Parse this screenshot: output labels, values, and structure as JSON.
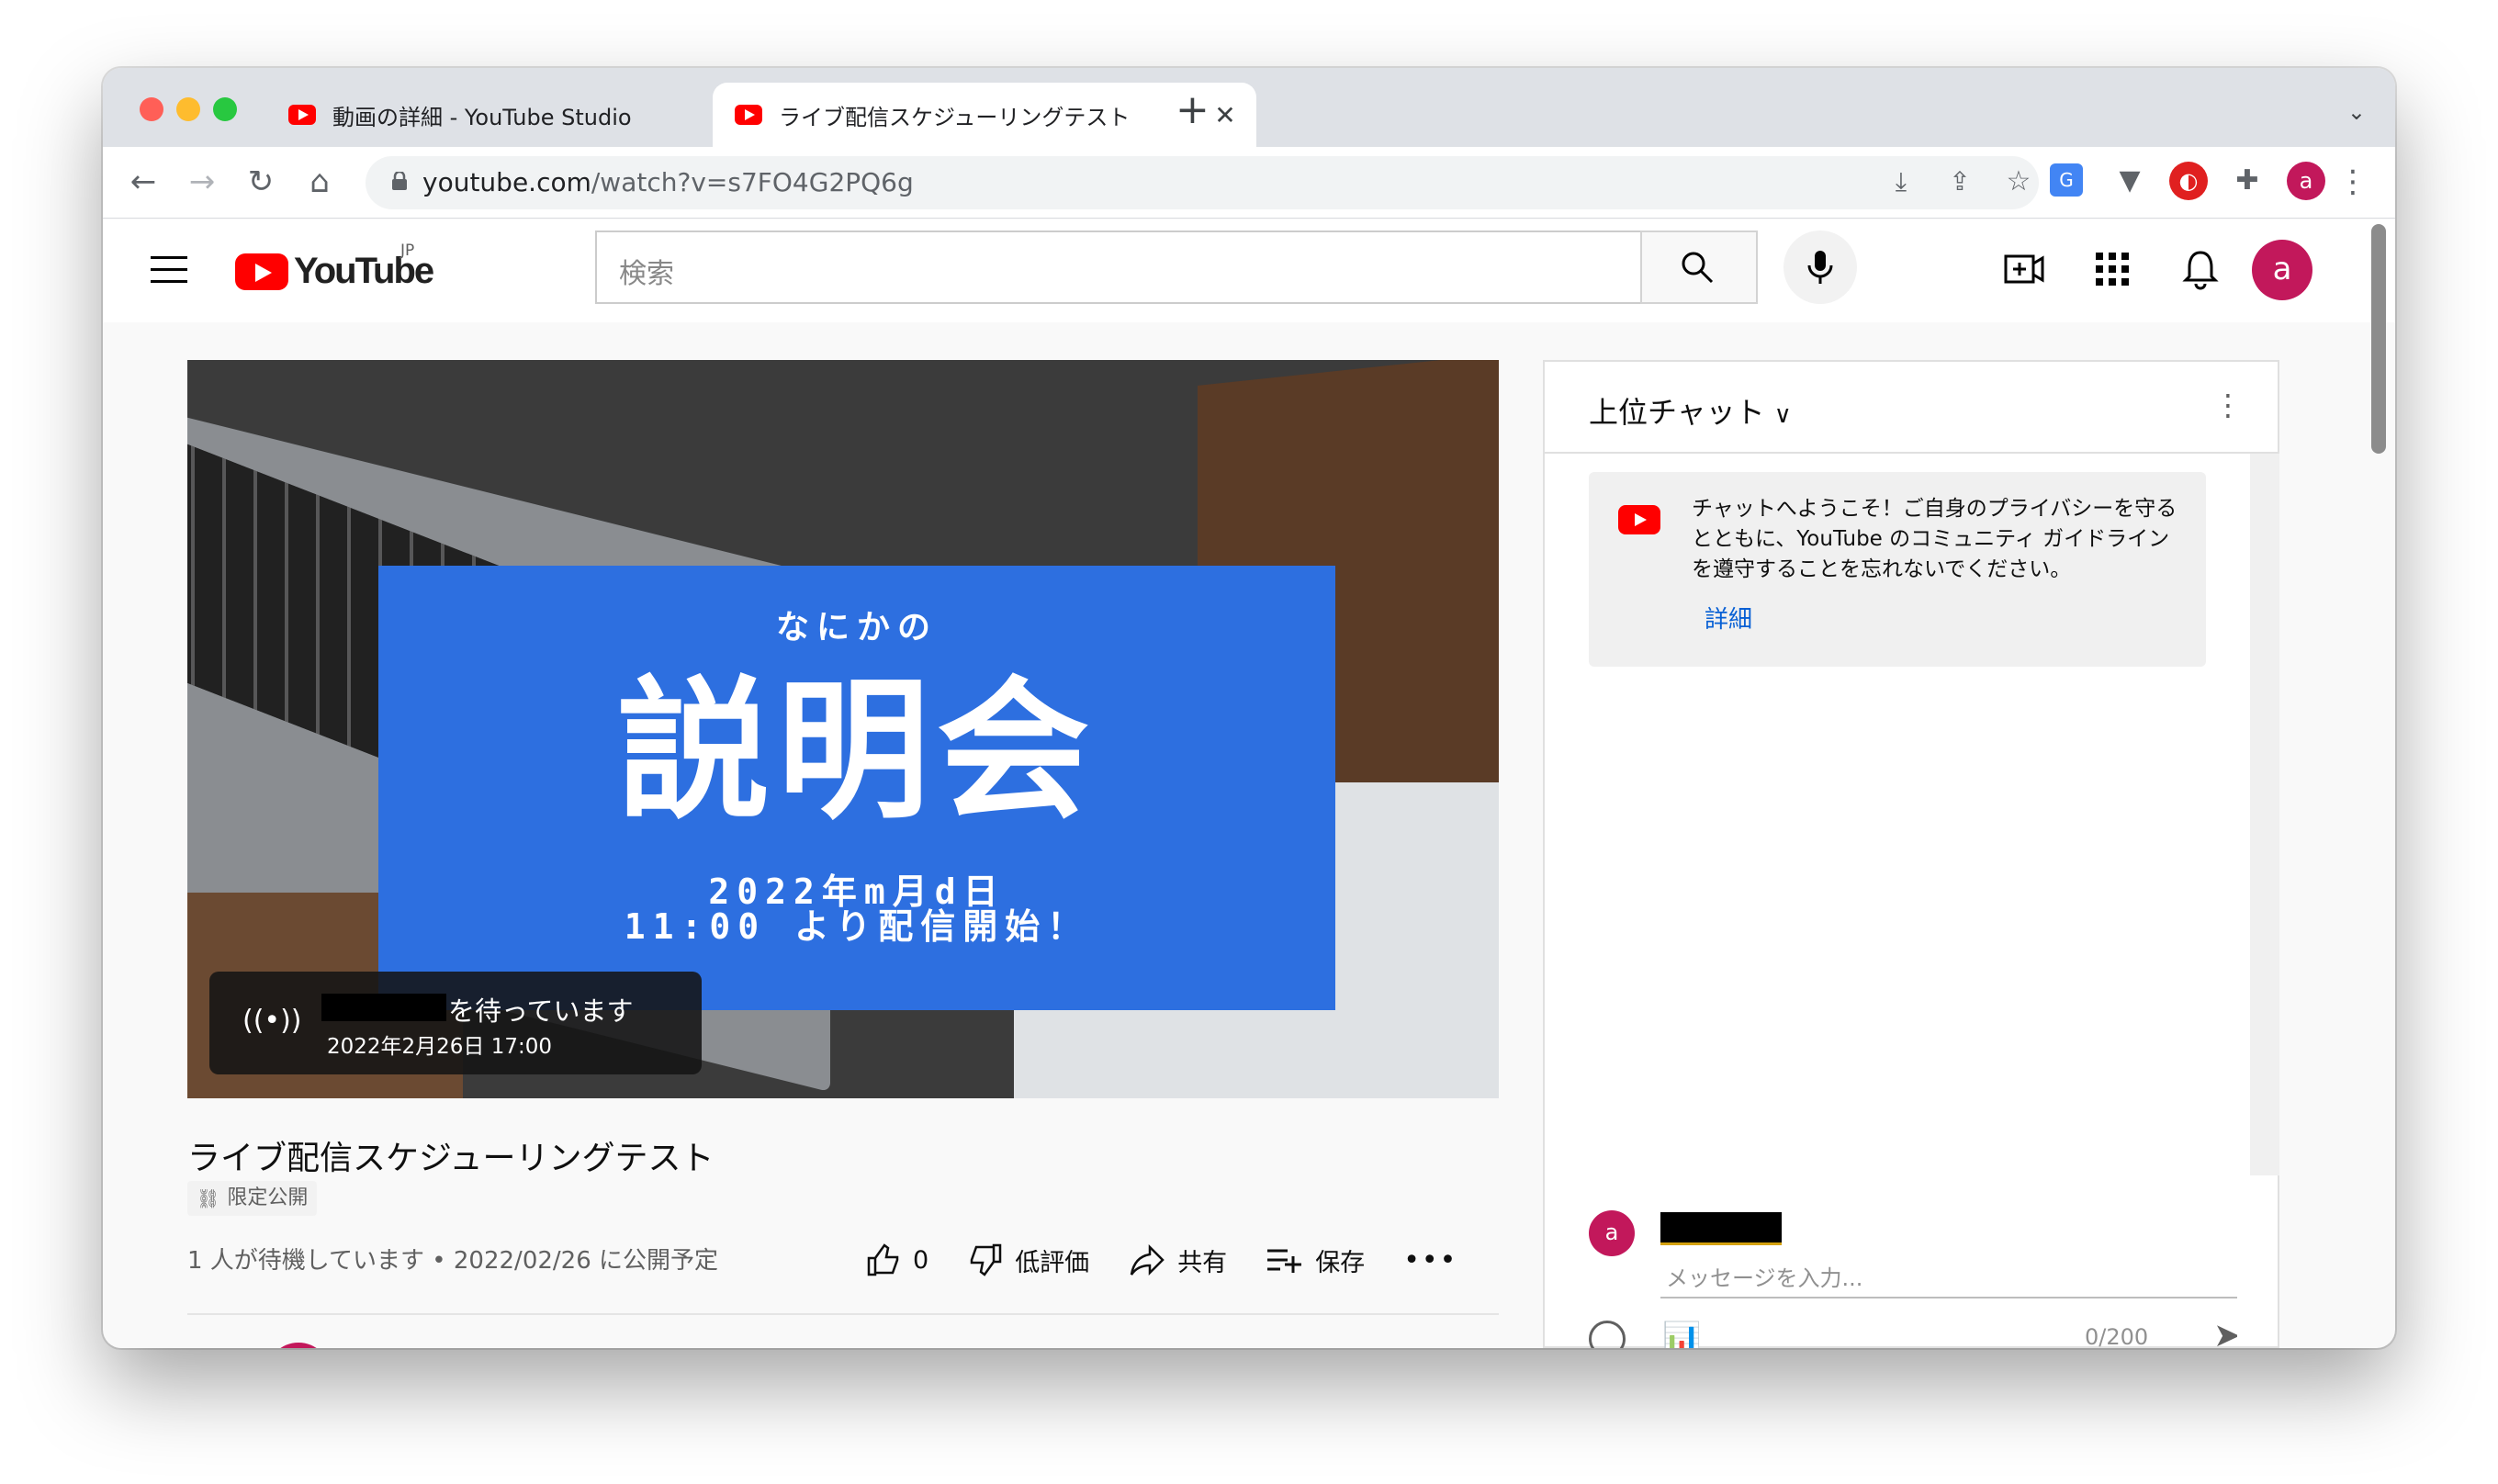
{
  "browser": {
    "tabs": [
      {
        "title": "動画の詳細 - YouTube Studio",
        "active": false
      },
      {
        "title": "ライブ配信スケジューリングテスト",
        "active": true
      }
    ],
    "url_host": "youtube.com",
    "url_path": "/watch?v=s7FO4G2PQ6g",
    "profile_initial": "a"
  },
  "masthead": {
    "logo_text": "YouTube",
    "country_code": "JP",
    "search_placeholder": "検索",
    "avatar_initial": "a"
  },
  "thumbnail": {
    "subtitle": "なにかの",
    "headline": "説明会",
    "date_line": "2022年m月d日",
    "time_line": "11:00 より配信開始！"
  },
  "waiting_overlay": {
    "message": "を待っています",
    "scheduled": "2022年2月26日 17:00"
  },
  "video": {
    "title": "ライブ配信スケジューリングテスト",
    "privacy": "限定公開",
    "info": "1 人が待機しています • 2022/02/26 に公開予定",
    "like_count": "0",
    "dislike_label": "低評価",
    "share_label": "共有",
    "save_label": "保存"
  },
  "chat": {
    "title": "上位チャット",
    "welcome_text": "チャットへようこそ！ご自身のプライバシーを守るとともに、YouTube のコミュニティ ガイドラインを遵守することを忘れないでください。",
    "learn_more": "詳細",
    "composer_initial": "a",
    "input_placeholder": "メッセージを入力...",
    "char_count": "0/200"
  },
  "colors": {
    "brand_red": "#ff0000",
    "avatar": "#c2185b",
    "banner_blue": "#2d6fe0",
    "link_blue": "#065fd4"
  }
}
